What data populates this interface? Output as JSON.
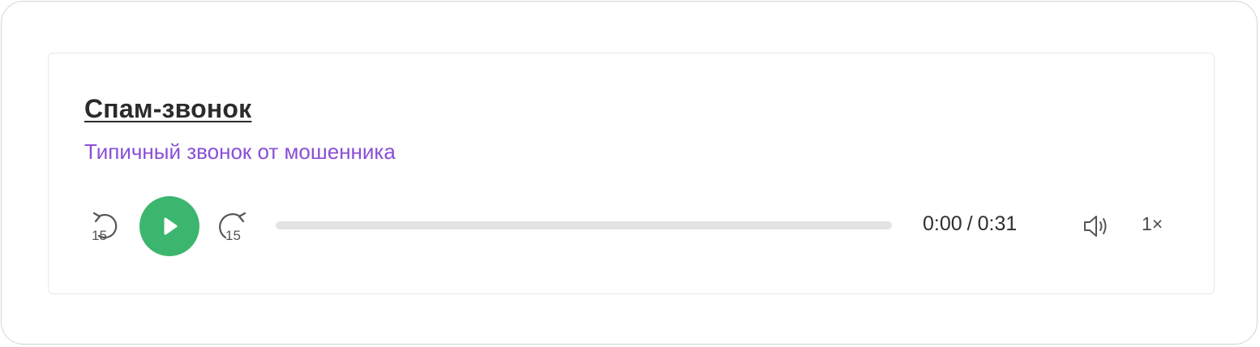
{
  "card": {
    "title": "Спам-звонок",
    "subtitle": "Типичный звонок от мошенника"
  },
  "player": {
    "skip_back_seconds": "15",
    "skip_forward_seconds": "15",
    "current_time": "0:00",
    "time_separator": "/",
    "duration": "0:31",
    "progress": 0,
    "speed": "1×",
    "state": "paused"
  },
  "icons": {
    "skip_back": "rewind-15-icon",
    "play": "play-icon",
    "skip_forward": "forward-15-icon",
    "volume": "volume-icon"
  },
  "colors": {
    "play_button": "#3cb66e",
    "subtitle": "#8a4fd6",
    "track": "#e3e3e3",
    "title": "#2b2b2b"
  }
}
